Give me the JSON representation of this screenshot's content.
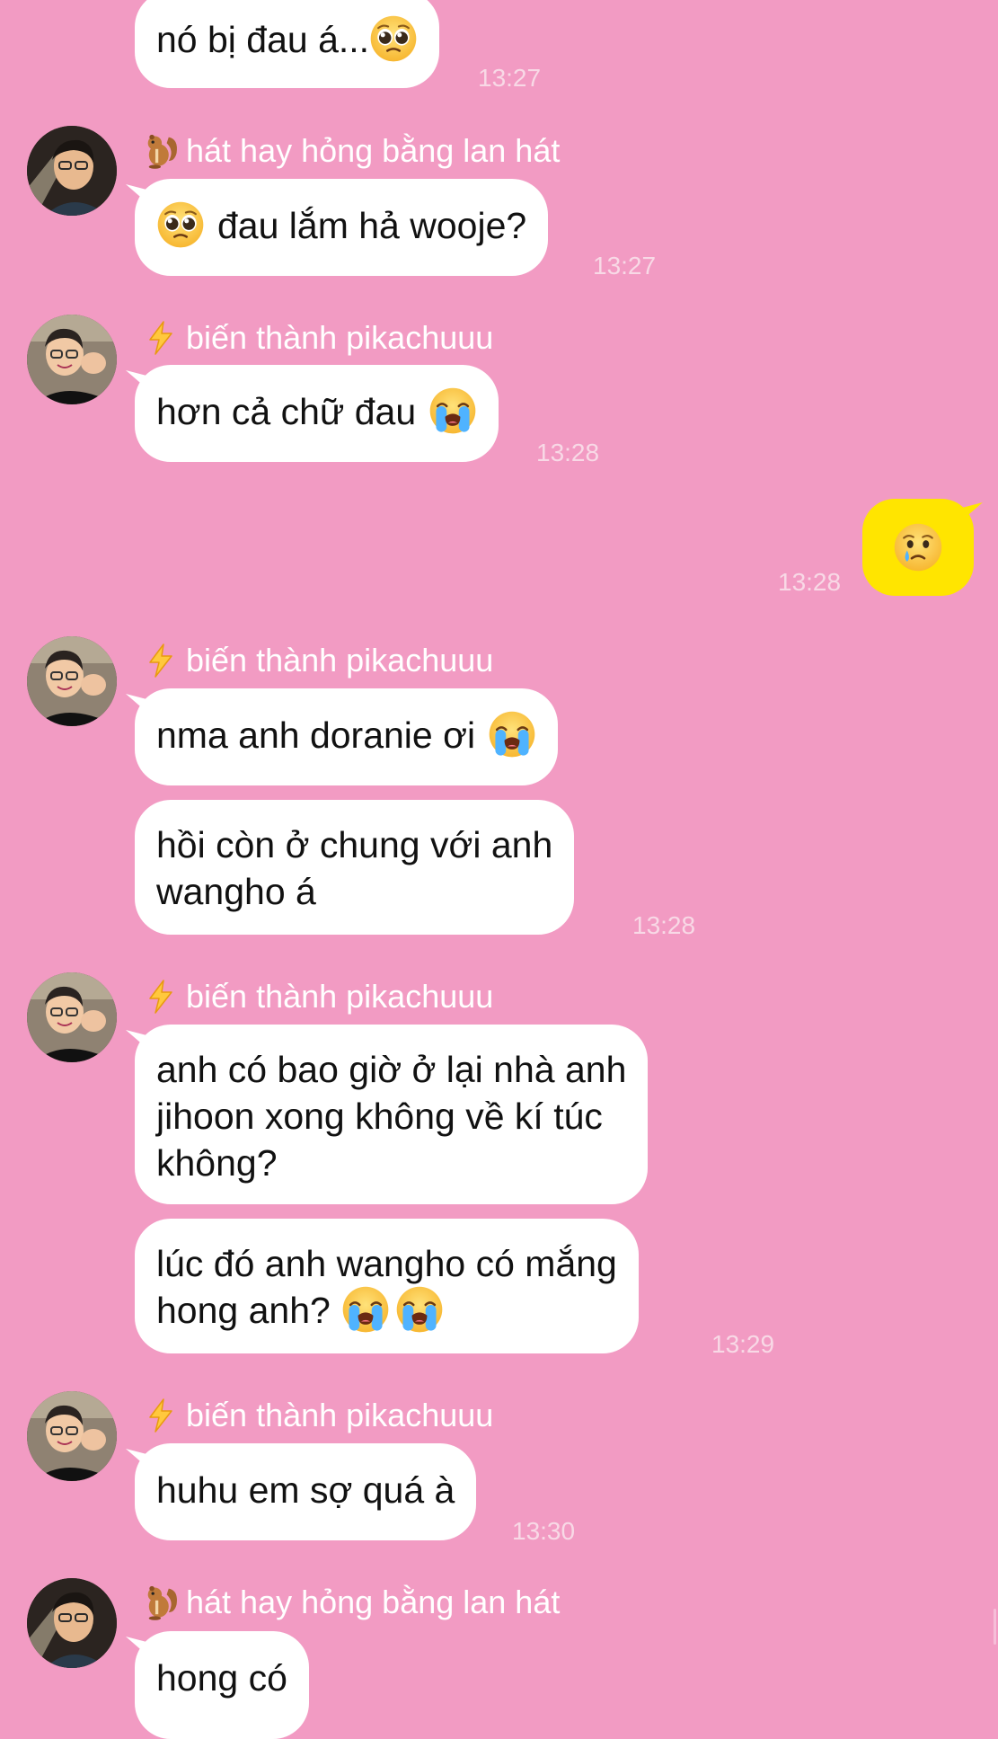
{
  "chat": {
    "messages": [
      {
        "text": "nó bị đau á...",
        "emoji": "pleading-face"
      },
      {
        "sender": "hát hay hỏng bằng lan hát",
        "sender_icon": "chipmunk-icon",
        "text": "đau lắm hả wooje?",
        "emoji": "pleading-face",
        "time": "13:27"
      },
      {
        "sender": "biến thành pikachuuu",
        "sender_icon": "lightning-icon",
        "text": "hơn cả chữ đau",
        "emoji": "loudly-crying-face",
        "time": "13:28"
      },
      {
        "own_emoji": "crying-face",
        "time": "13:28"
      },
      {
        "sender": "biến thành pikachuuu",
        "sender_icon": "lightning-icon",
        "text": "nma anh doranie ơi",
        "emoji": "loudly-crying-face"
      },
      {
        "text_lines": [
          "hồi còn ở chung với anh",
          "wangho á"
        ],
        "time": "13:28"
      },
      {
        "sender": "biến thành pikachuuu",
        "sender_icon": "lightning-icon",
        "text_lines": [
          "anh có bao giờ ở lại nhà anh",
          "jihoon xong không về kí túc",
          "không?"
        ]
      },
      {
        "text_lines": [
          "lúc đó anh wangho có mắng",
          "hong anh?"
        ],
        "emoji": "loudly-crying-face",
        "time": "13:29"
      },
      {
        "sender": "biến thành pikachuuu",
        "sender_icon": "lightning-icon",
        "text": "huhu em sợ quá à",
        "time": "13:30"
      },
      {
        "sender": "hát hay hỏng bằng lan hát",
        "sender_icon": "chipmunk-icon",
        "text": "hong có"
      }
    ],
    "first_time": "13:27"
  },
  "colors": {
    "background": "#F29BC3",
    "bubble_incoming": "#FFFFFF",
    "bubble_outgoing": "#FFE500",
    "timestamp": "#F8D9E6"
  }
}
